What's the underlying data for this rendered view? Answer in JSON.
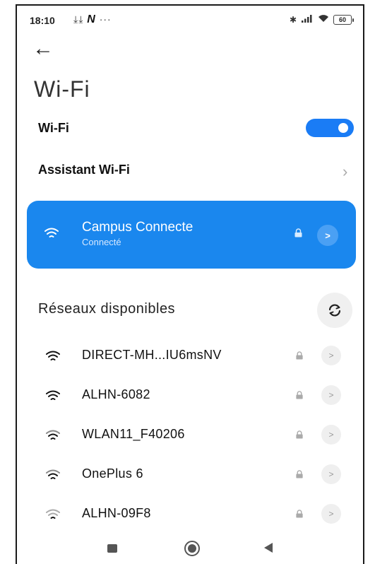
{
  "status_bar": {
    "time": "18:10",
    "left_icons": [
      "download-icon",
      "download-icon",
      "n-app-icon",
      "more-dots"
    ],
    "battery": "60"
  },
  "header": {
    "title": "Wi-Fi"
  },
  "wifi_toggle": {
    "label": "Wi-Fi",
    "on": true
  },
  "assistant": {
    "label": "Assistant Wi-Fi"
  },
  "connected_network": {
    "name": "Campus Connecte",
    "status": "Connecté"
  },
  "available": {
    "title": "Réseaux disponibles",
    "networks": [
      {
        "name": "DIRECT-MH...IU6msNV"
      },
      {
        "name": "ALHN-6082"
      },
      {
        "name": "WLAN11_F40206"
      },
      {
        "name": "OnePlus 6"
      },
      {
        "name": "ALHN-09F8"
      }
    ]
  },
  "colors": {
    "accent": "#1a87ee",
    "toggle": "#1a7cf5"
  }
}
